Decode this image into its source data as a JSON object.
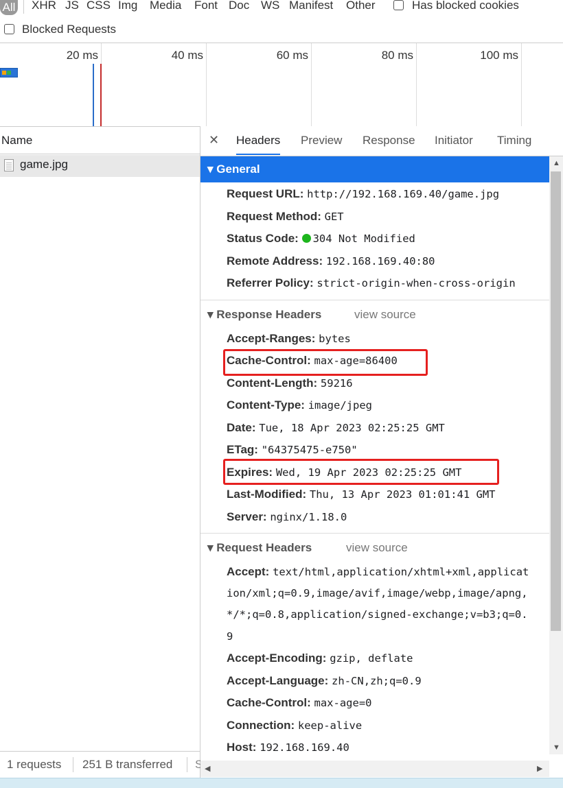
{
  "filters": {
    "types": [
      "All",
      "XHR",
      "JS",
      "CSS",
      "Img",
      "Media",
      "Font",
      "Doc",
      "WS",
      "Manifest",
      "Other"
    ],
    "has_blocked_cookies": "Has blocked cookies",
    "blocked_requests": "Blocked Requests"
  },
  "timeline": {
    "ticks": [
      "20 ms",
      "40 ms",
      "60 ms",
      "80 ms",
      "100 ms"
    ]
  },
  "requests": {
    "column_name": "Name",
    "items": [
      "game.jpg"
    ],
    "status_count": "1 requests",
    "status_transferred": "251 B transferred"
  },
  "details": {
    "tabs": [
      "Headers",
      "Preview",
      "Response",
      "Initiator",
      "Timing"
    ],
    "active_tab": "Headers",
    "general": {
      "title": "General",
      "rows": [
        {
          "k": "Request URL:",
          "v": "http://192.168.169.40/game.jpg"
        },
        {
          "k": "Request Method:",
          "v": "GET"
        },
        {
          "k": "Status Code:",
          "v": "304 Not Modified"
        },
        {
          "k": "Remote Address:",
          "v": "192.168.169.40:80"
        },
        {
          "k": "Referrer Policy:",
          "v": "strict-origin-when-cross-origin"
        }
      ]
    },
    "response_headers": {
      "title": "Response Headers",
      "view_source": "view source",
      "rows": [
        {
          "k": "Accept-Ranges:",
          "v": "bytes"
        },
        {
          "k": "Cache-Control:",
          "v": "max-age=86400"
        },
        {
          "k": "Content-Length:",
          "v": "59216"
        },
        {
          "k": "Content-Type:",
          "v": "image/jpeg"
        },
        {
          "k": "Date:",
          "v": "Tue, 18 Apr 2023 02:25:25 GMT"
        },
        {
          "k": "ETag:",
          "v": "\"64375475-e750\""
        },
        {
          "k": "Expires:",
          "v": "Wed, 19 Apr 2023 02:25:25 GMT"
        },
        {
          "k": "Last-Modified:",
          "v": "Thu, 13 Apr 2023 01:01:41 GMT"
        },
        {
          "k": "Server:",
          "v": "nginx/1.18.0"
        }
      ]
    },
    "request_headers": {
      "title": "Request Headers",
      "view_source": "view source",
      "accept_key": "Accept:",
      "accept_lines": [
        "text/html,application/xhtml+xml,applicat",
        "ion/xml;q=0.9,image/avif,image/webp,image/apng,",
        "*/*;q=0.8,application/signed-exchange;v=b3;q=0.",
        "9"
      ],
      "rows": [
        {
          "k": "Accept-Encoding:",
          "v": "gzip, deflate"
        },
        {
          "k": "Accept-Language:",
          "v": "zh-CN,zh;q=0.9"
        },
        {
          "k": "Cache-Control:",
          "v": "max-age=0"
        },
        {
          "k": "Connection:",
          "v": "keep-alive"
        },
        {
          "k": "Host:",
          "v": "192.168.169.40"
        }
      ]
    }
  },
  "colors": {
    "accent": "#1a73e8",
    "highlight": "#e5201f",
    "status_ok": "#1db51d"
  }
}
